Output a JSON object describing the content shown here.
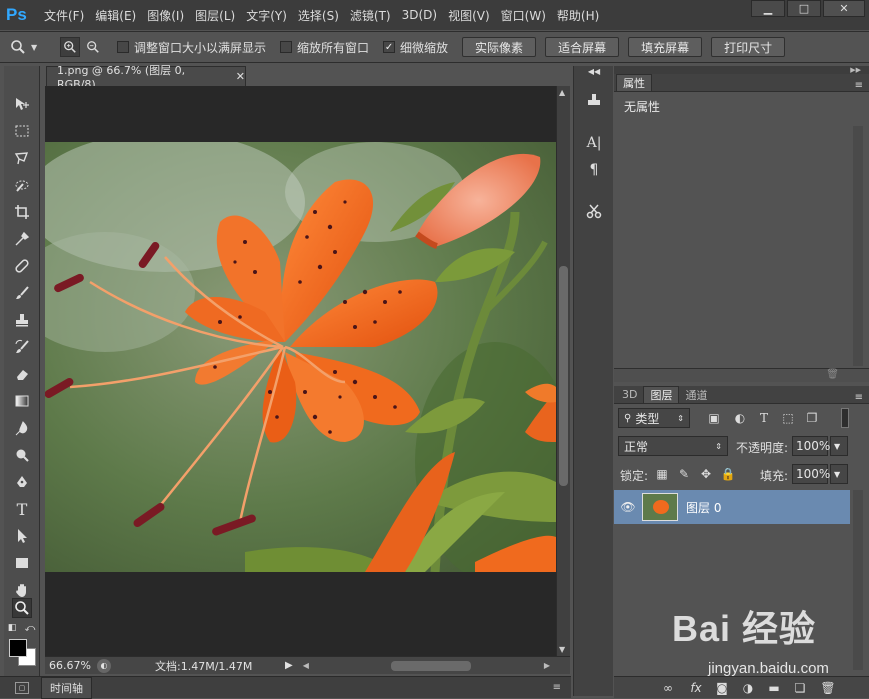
{
  "app": {
    "logo": "Ps"
  },
  "menu": [
    "文件(F)",
    "编辑(E)",
    "图像(I)",
    "图层(L)",
    "文字(Y)",
    "选择(S)",
    "滤镜(T)",
    "3D(D)",
    "视图(V)",
    "窗口(W)",
    "帮助(H)"
  ],
  "window_controls": {
    "minimize": "▁",
    "maximize": "□",
    "close": "✕"
  },
  "options": {
    "check1": {
      "label": "调整窗口大小以满屏显示",
      "checked": false
    },
    "check2": {
      "label": "缩放所有窗口",
      "checked": false
    },
    "check3": {
      "label": "细微缩放",
      "checked": true
    },
    "buttons": [
      "实际像素",
      "适合屏幕",
      "填充屏幕",
      "打印尺寸"
    ]
  },
  "document": {
    "tab_title": "1.png @ 66.7% (图层 0, RGB/8)",
    "zoom": "66.67%",
    "doc_size": "文档:1.47M/1.47M"
  },
  "timeline_label": "时间轴",
  "properties": {
    "tab": "属性",
    "content": "无属性"
  },
  "layers_panel": {
    "tabs": [
      "3D",
      "图层",
      "通道"
    ],
    "active_tab": "图层",
    "filter_kind": "类型",
    "blend_mode": "正常",
    "opacity_label": "不透明度:",
    "opacity_value": "100%",
    "lock_label": "锁定:",
    "fill_label": "填充:",
    "fill_value": "100%",
    "layers": [
      {
        "name": "图层 0",
        "visible": true
      }
    ]
  },
  "watermark": {
    "brand": "Bai 经验",
    "url": "jingyan.baidu.com"
  },
  "colors": {
    "accent": "#31a8ff",
    "selected_layer": "#6a8ab0",
    "lily": "#f06a1e"
  }
}
